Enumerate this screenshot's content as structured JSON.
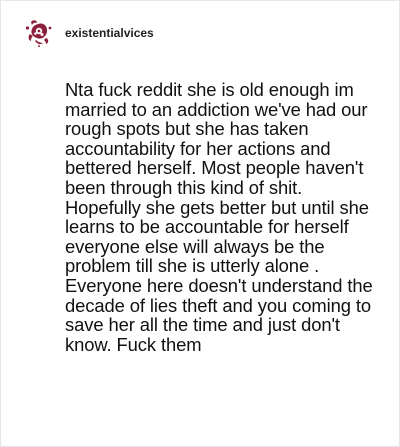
{
  "post": {
    "username": "existentialvices",
    "avatar_icon": "avatar-icon",
    "body": "Nta fuck reddit she is old enough im married to an addiction we've had our rough spots but she has taken accountability for her actions and bettered herself. Most people haven't been through this kind of shit. Hopefully she gets better but until she learns to be accountable for herself everyone else will always be the problem till she is utterly alone . Everyone here doesn't understand the decade of lies theft and you coming to save her all the time and just don't know. Fuck them"
  },
  "colors": {
    "avatar_primary": "#8e1f3a",
    "avatar_background": "#ffffff",
    "text": "#111111",
    "border": "#e6e6e6"
  }
}
